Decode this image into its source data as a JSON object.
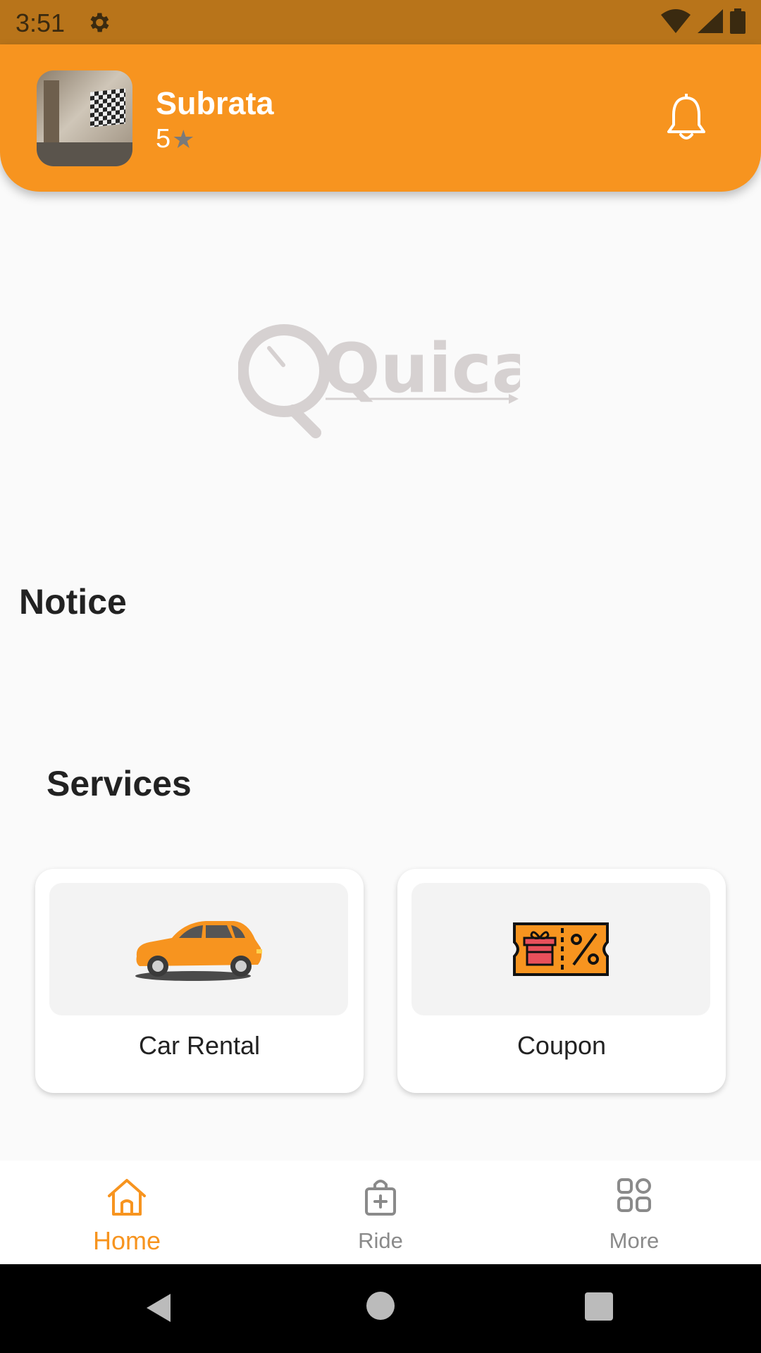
{
  "status_bar": {
    "time": "3:51",
    "icons": [
      "gear-icon",
      "wifi-icon",
      "signal-icon",
      "battery-icon"
    ]
  },
  "header": {
    "user_name": "Subrata",
    "rating": "5",
    "rating_icon": "star-icon",
    "notification_icon": "bell-icon"
  },
  "logo": {
    "text": "Quicar"
  },
  "notice": {
    "title": "Notice"
  },
  "services": {
    "title": "Services",
    "items": [
      {
        "label": "Car Rental",
        "icon": "car-icon"
      },
      {
        "label": "Coupon",
        "icon": "coupon-icon"
      }
    ]
  },
  "bottom_nav": {
    "items": [
      {
        "label": "Home",
        "icon": "home-icon",
        "active": true
      },
      {
        "label": "Ride",
        "icon": "bag-plus-icon",
        "active": false
      },
      {
        "label": "More",
        "icon": "grid-icon",
        "active": false
      }
    ]
  },
  "colors": {
    "accent": "#f7941f",
    "status_bar": "#b8741a",
    "background": "#fafafa",
    "inactive": "#8a8a8a"
  }
}
